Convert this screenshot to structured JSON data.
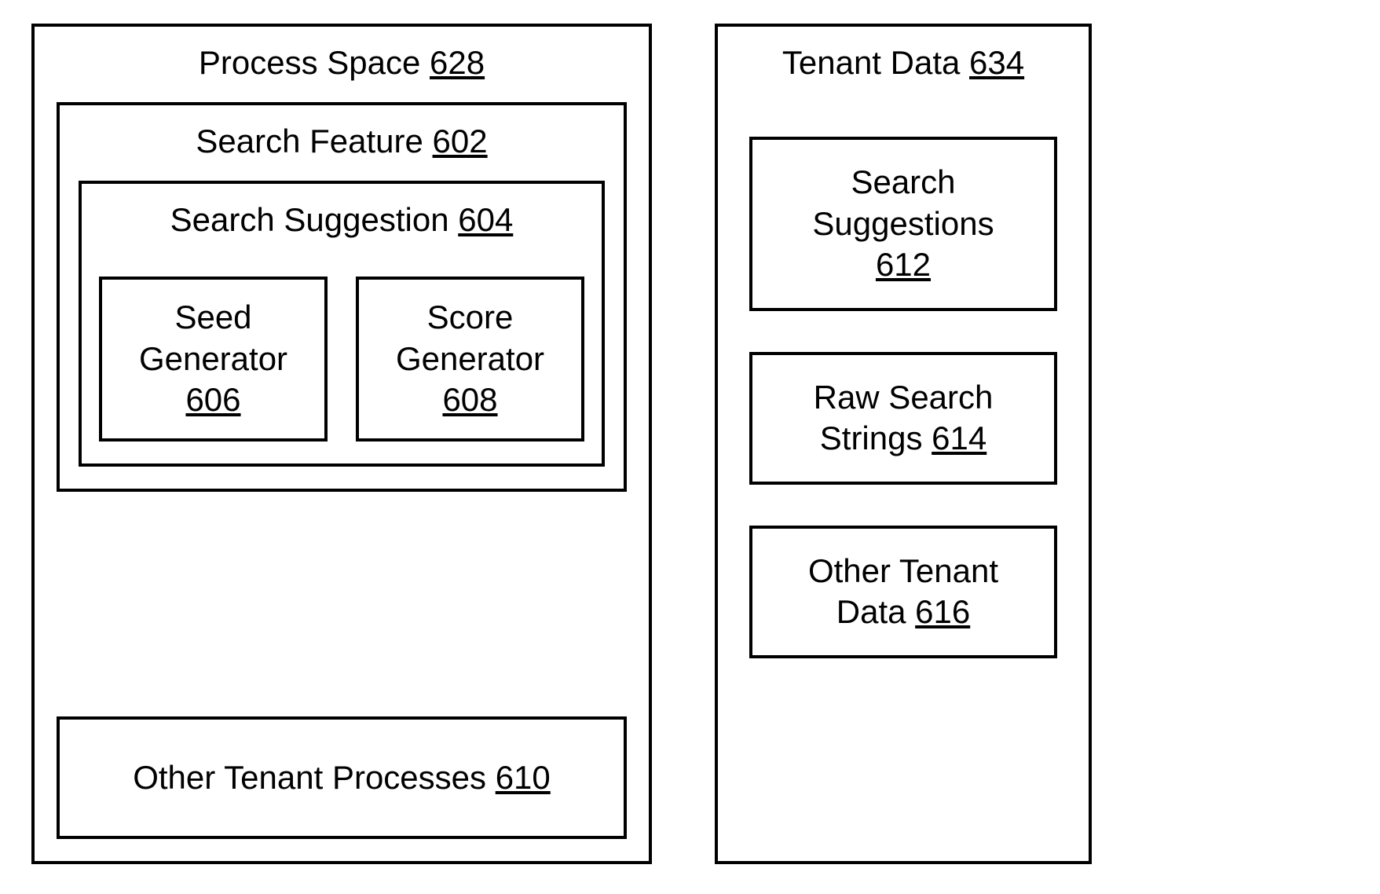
{
  "processSpace": {
    "title": "Process Space",
    "ref": "628",
    "searchFeature": {
      "title": "Search Feature",
      "ref": "602",
      "searchSuggestion": {
        "title": "Search Suggestion",
        "ref": "604",
        "seedGenerator": {
          "line1": "Seed",
          "line2": "Generator",
          "ref": "606"
        },
        "scoreGenerator": {
          "line1": "Score",
          "line2": "Generator",
          "ref": "608"
        }
      }
    },
    "otherTenantProcesses": {
      "title": "Other Tenant Processes",
      "ref": "610"
    }
  },
  "tenantData": {
    "title": "Tenant Data",
    "ref": "634",
    "searchSuggestions": {
      "line1": "Search",
      "line2": "Suggestions",
      "ref": "612"
    },
    "rawSearchStrings": {
      "line1": "Raw Search",
      "line2": "Strings",
      "ref": "614"
    },
    "otherTenantData": {
      "line1": "Other Tenant",
      "line2": "Data",
      "ref": "616"
    }
  }
}
